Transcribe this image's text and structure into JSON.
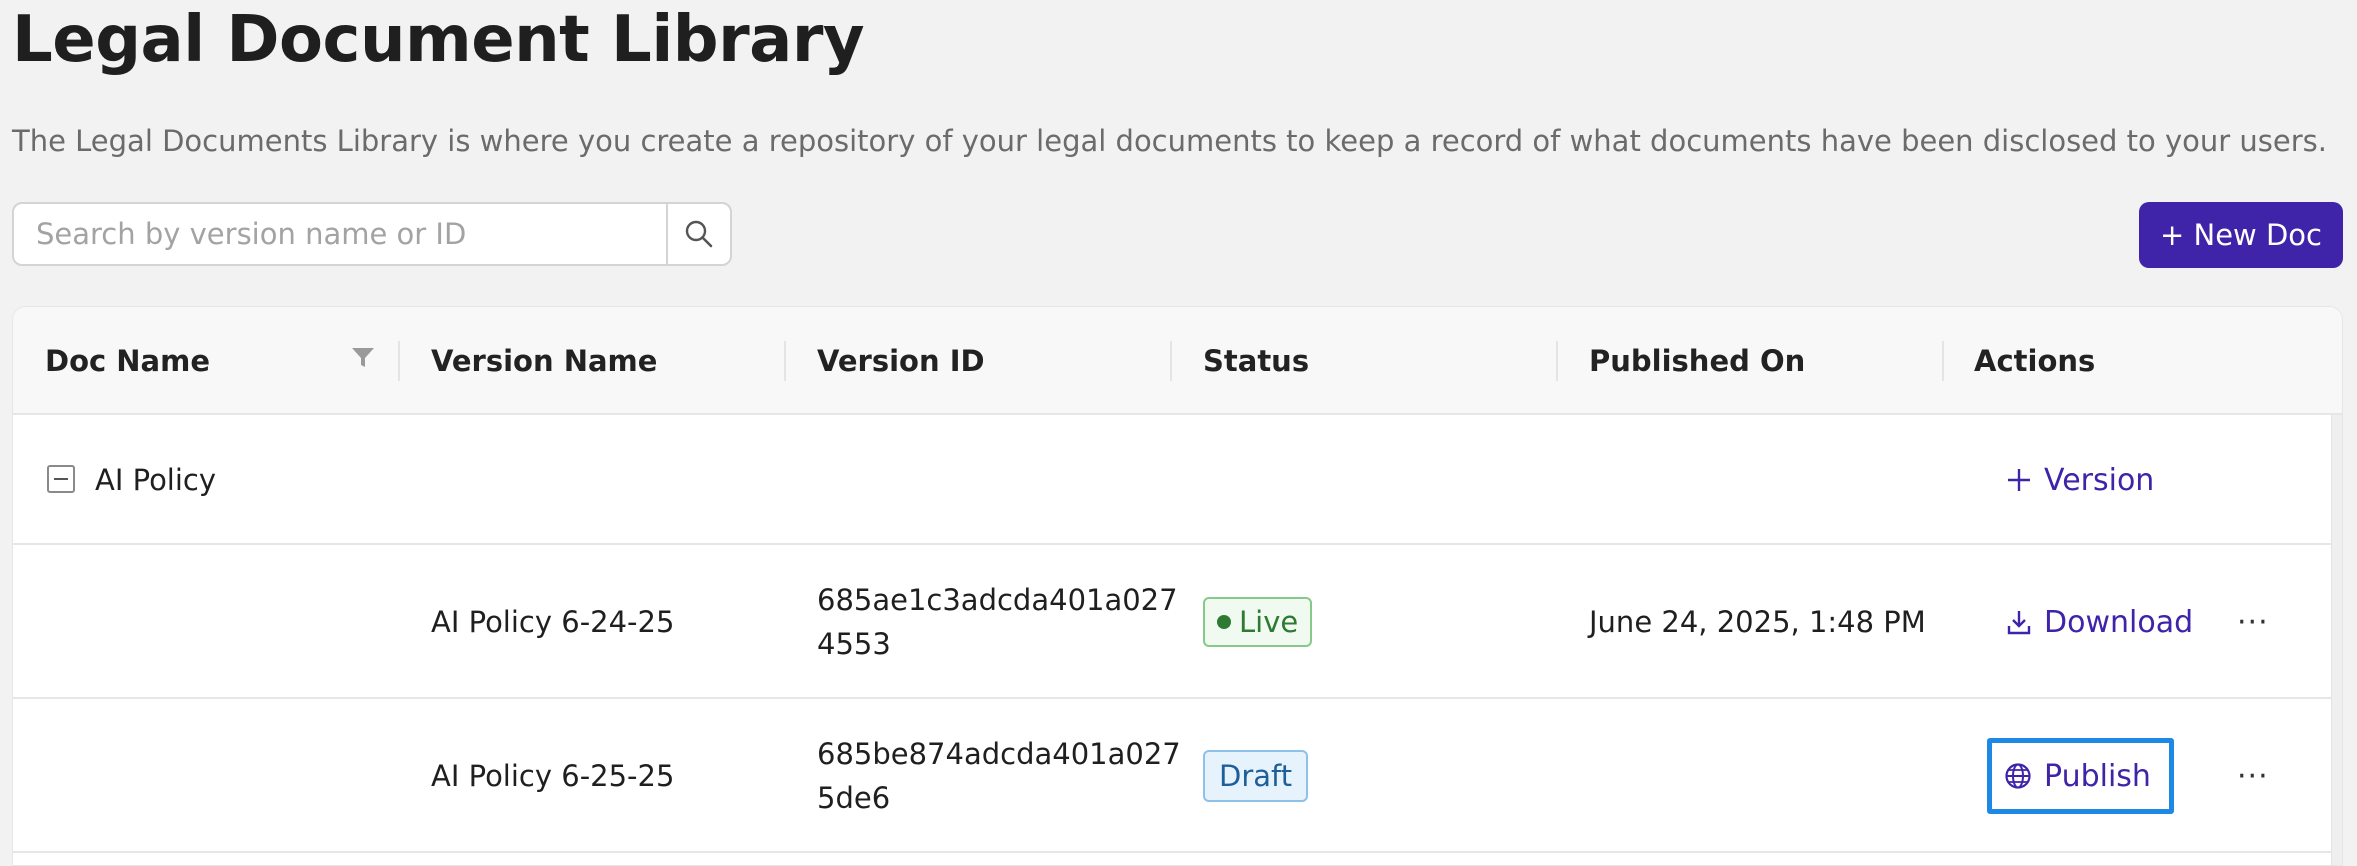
{
  "header": {
    "title": "Legal Document Library",
    "description": "The Legal Documents Library is where you create a repository of your legal documents to keep a record of what documents have been disclosed to your users."
  },
  "search": {
    "placeholder": "Search by version name or ID",
    "value": "",
    "icon": "search-icon"
  },
  "new_doc_button": {
    "label": "+ New Doc"
  },
  "table": {
    "columns": [
      "Doc Name",
      "Version Name",
      "Version ID",
      "Status",
      "Published On",
      "Actions"
    ],
    "group": {
      "doc_name": "AI Policy",
      "action_label": "Version",
      "action_icon": "plus-icon"
    },
    "rows": [
      {
        "version_name": "AI Policy 6-24-25",
        "version_id_line1": "685ae1c3adcda401a027",
        "version_id_line2": "4553",
        "status": "Live",
        "published_on": "June 24, 2025, 1:48 PM",
        "action_label": "Download",
        "action_icon": "download-icon",
        "more": "···"
      },
      {
        "version_name": "AI Policy 6-25-25",
        "version_id_line1": "685be874adcda401a027",
        "version_id_line2": "5de6",
        "status": "Draft",
        "published_on": "",
        "action_label": "Publish",
        "action_icon": "globe-icon",
        "more": "···"
      }
    ]
  },
  "colors": {
    "accent": "#3f23a8",
    "live_text": "#2e7a32",
    "draft_text": "#1f5f99",
    "focus_ring": "#1e88e5"
  }
}
